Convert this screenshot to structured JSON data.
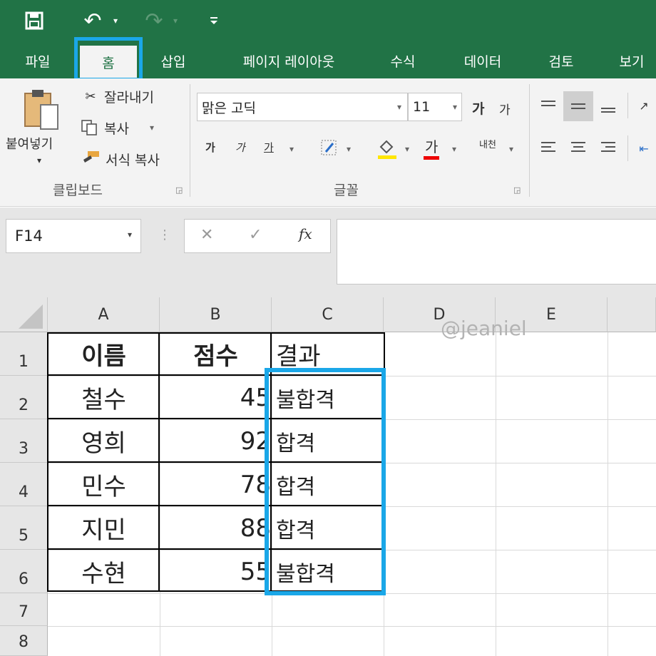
{
  "quick_access": {
    "save_icon": "save-icon",
    "undo_icon": "undo-icon",
    "redo_icon": "redo-icon"
  },
  "tabs": [
    {
      "label": "파일"
    },
    {
      "label": "홈"
    },
    {
      "label": "삽입"
    },
    {
      "label": "페이지 레이아웃"
    },
    {
      "label": "수식"
    },
    {
      "label": "데이터"
    },
    {
      "label": "검토"
    },
    {
      "label": "보기"
    }
  ],
  "ribbon": {
    "clipboard": {
      "paste_label": "붙여넣기",
      "cut_label": "잘라내기",
      "copy_label": "복사",
      "format_painter_label": "서식 복사",
      "group_label": "클립보드"
    },
    "font": {
      "font_name": "맑은 고딕",
      "font_size": "11",
      "grow_label": "가",
      "shrink_label": "가",
      "bold_label": "가",
      "italic_label": "가",
      "underline_label": "가",
      "font_color_label": "가",
      "phonetic_label": "내천",
      "group_label": "글꼴"
    }
  },
  "formula_bar": {
    "name_box": "F14",
    "cancel_icon": "✕",
    "enter_icon": "✓",
    "fx_label": "fx",
    "formula": ""
  },
  "sheet": {
    "columns": [
      "A",
      "B",
      "C",
      "D",
      "E"
    ],
    "rows": [
      "1",
      "2",
      "3",
      "4",
      "5",
      "6",
      "7",
      "8"
    ],
    "header": {
      "a": "이름",
      "b": "점수",
      "c": "결과"
    },
    "data": [
      {
        "name": "철수",
        "score": "45",
        "result": "불합격"
      },
      {
        "name": "영희",
        "score": "92",
        "result": "합격"
      },
      {
        "name": "민수",
        "score": "78",
        "result": "합격"
      },
      {
        "name": "지민",
        "score": "88",
        "result": "합격"
      },
      {
        "name": "수현",
        "score": "55",
        "result": "불합격"
      }
    ]
  },
  "watermark": "@jeaniel",
  "colors": {
    "ribbon_green": "#217346",
    "highlight_blue": "#1aa7e8"
  }
}
